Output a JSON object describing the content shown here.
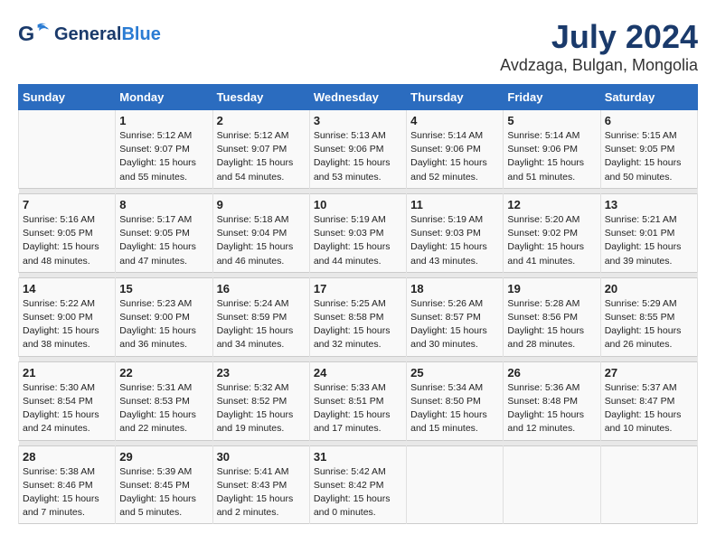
{
  "header": {
    "logo_general": "General",
    "logo_blue": "Blue",
    "title": "July 2024",
    "subtitle": "Avdzaga, Bulgan, Mongolia"
  },
  "days_of_week": [
    "Sunday",
    "Monday",
    "Tuesday",
    "Wednesday",
    "Thursday",
    "Friday",
    "Saturday"
  ],
  "weeks": [
    [
      {
        "day": "",
        "sunrise": "",
        "sunset": "",
        "daylight": ""
      },
      {
        "day": "1",
        "sunrise": "Sunrise: 5:12 AM",
        "sunset": "Sunset: 9:07 PM",
        "daylight": "Daylight: 15 hours and 55 minutes."
      },
      {
        "day": "2",
        "sunrise": "Sunrise: 5:12 AM",
        "sunset": "Sunset: 9:07 PM",
        "daylight": "Daylight: 15 hours and 54 minutes."
      },
      {
        "day": "3",
        "sunrise": "Sunrise: 5:13 AM",
        "sunset": "Sunset: 9:06 PM",
        "daylight": "Daylight: 15 hours and 53 minutes."
      },
      {
        "day": "4",
        "sunrise": "Sunrise: 5:14 AM",
        "sunset": "Sunset: 9:06 PM",
        "daylight": "Daylight: 15 hours and 52 minutes."
      },
      {
        "day": "5",
        "sunrise": "Sunrise: 5:14 AM",
        "sunset": "Sunset: 9:06 PM",
        "daylight": "Daylight: 15 hours and 51 minutes."
      },
      {
        "day": "6",
        "sunrise": "Sunrise: 5:15 AM",
        "sunset": "Sunset: 9:05 PM",
        "daylight": "Daylight: 15 hours and 50 minutes."
      }
    ],
    [
      {
        "day": "7",
        "sunrise": "Sunrise: 5:16 AM",
        "sunset": "Sunset: 9:05 PM",
        "daylight": "Daylight: 15 hours and 48 minutes."
      },
      {
        "day": "8",
        "sunrise": "Sunrise: 5:17 AM",
        "sunset": "Sunset: 9:05 PM",
        "daylight": "Daylight: 15 hours and 47 minutes."
      },
      {
        "day": "9",
        "sunrise": "Sunrise: 5:18 AM",
        "sunset": "Sunset: 9:04 PM",
        "daylight": "Daylight: 15 hours and 46 minutes."
      },
      {
        "day": "10",
        "sunrise": "Sunrise: 5:19 AM",
        "sunset": "Sunset: 9:03 PM",
        "daylight": "Daylight: 15 hours and 44 minutes."
      },
      {
        "day": "11",
        "sunrise": "Sunrise: 5:19 AM",
        "sunset": "Sunset: 9:03 PM",
        "daylight": "Daylight: 15 hours and 43 minutes."
      },
      {
        "day": "12",
        "sunrise": "Sunrise: 5:20 AM",
        "sunset": "Sunset: 9:02 PM",
        "daylight": "Daylight: 15 hours and 41 minutes."
      },
      {
        "day": "13",
        "sunrise": "Sunrise: 5:21 AM",
        "sunset": "Sunset: 9:01 PM",
        "daylight": "Daylight: 15 hours and 39 minutes."
      }
    ],
    [
      {
        "day": "14",
        "sunrise": "Sunrise: 5:22 AM",
        "sunset": "Sunset: 9:00 PM",
        "daylight": "Daylight: 15 hours and 38 minutes."
      },
      {
        "day": "15",
        "sunrise": "Sunrise: 5:23 AM",
        "sunset": "Sunset: 9:00 PM",
        "daylight": "Daylight: 15 hours and 36 minutes."
      },
      {
        "day": "16",
        "sunrise": "Sunrise: 5:24 AM",
        "sunset": "Sunset: 8:59 PM",
        "daylight": "Daylight: 15 hours and 34 minutes."
      },
      {
        "day": "17",
        "sunrise": "Sunrise: 5:25 AM",
        "sunset": "Sunset: 8:58 PM",
        "daylight": "Daylight: 15 hours and 32 minutes."
      },
      {
        "day": "18",
        "sunrise": "Sunrise: 5:26 AM",
        "sunset": "Sunset: 8:57 PM",
        "daylight": "Daylight: 15 hours and 30 minutes."
      },
      {
        "day": "19",
        "sunrise": "Sunrise: 5:28 AM",
        "sunset": "Sunset: 8:56 PM",
        "daylight": "Daylight: 15 hours and 28 minutes."
      },
      {
        "day": "20",
        "sunrise": "Sunrise: 5:29 AM",
        "sunset": "Sunset: 8:55 PM",
        "daylight": "Daylight: 15 hours and 26 minutes."
      }
    ],
    [
      {
        "day": "21",
        "sunrise": "Sunrise: 5:30 AM",
        "sunset": "Sunset: 8:54 PM",
        "daylight": "Daylight: 15 hours and 24 minutes."
      },
      {
        "day": "22",
        "sunrise": "Sunrise: 5:31 AM",
        "sunset": "Sunset: 8:53 PM",
        "daylight": "Daylight: 15 hours and 22 minutes."
      },
      {
        "day": "23",
        "sunrise": "Sunrise: 5:32 AM",
        "sunset": "Sunset: 8:52 PM",
        "daylight": "Daylight: 15 hours and 19 minutes."
      },
      {
        "day": "24",
        "sunrise": "Sunrise: 5:33 AM",
        "sunset": "Sunset: 8:51 PM",
        "daylight": "Daylight: 15 hours and 17 minutes."
      },
      {
        "day": "25",
        "sunrise": "Sunrise: 5:34 AM",
        "sunset": "Sunset: 8:50 PM",
        "daylight": "Daylight: 15 hours and 15 minutes."
      },
      {
        "day": "26",
        "sunrise": "Sunrise: 5:36 AM",
        "sunset": "Sunset: 8:48 PM",
        "daylight": "Daylight: 15 hours and 12 minutes."
      },
      {
        "day": "27",
        "sunrise": "Sunrise: 5:37 AM",
        "sunset": "Sunset: 8:47 PM",
        "daylight": "Daylight: 15 hours and 10 minutes."
      }
    ],
    [
      {
        "day": "28",
        "sunrise": "Sunrise: 5:38 AM",
        "sunset": "Sunset: 8:46 PM",
        "daylight": "Daylight: 15 hours and 7 minutes."
      },
      {
        "day": "29",
        "sunrise": "Sunrise: 5:39 AM",
        "sunset": "Sunset: 8:45 PM",
        "daylight": "Daylight: 15 hours and 5 minutes."
      },
      {
        "day": "30",
        "sunrise": "Sunrise: 5:41 AM",
        "sunset": "Sunset: 8:43 PM",
        "daylight": "Daylight: 15 hours and 2 minutes."
      },
      {
        "day": "31",
        "sunrise": "Sunrise: 5:42 AM",
        "sunset": "Sunset: 8:42 PM",
        "daylight": "Daylight: 15 hours and 0 minutes."
      },
      {
        "day": "",
        "sunrise": "",
        "sunset": "",
        "daylight": ""
      },
      {
        "day": "",
        "sunrise": "",
        "sunset": "",
        "daylight": ""
      },
      {
        "day": "",
        "sunrise": "",
        "sunset": "",
        "daylight": ""
      }
    ]
  ]
}
